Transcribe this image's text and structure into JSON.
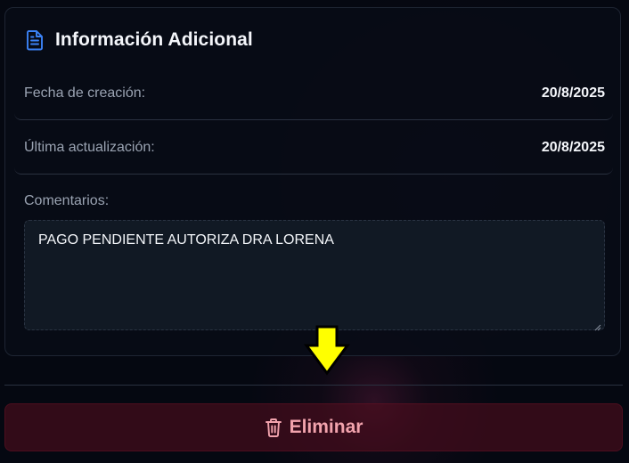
{
  "card": {
    "title": "Información Adicional",
    "title_icon": "document-icon",
    "accent_color": "#3b82f6"
  },
  "fields": {
    "created_label": "Fecha de creación:",
    "created_value": "20/8/2025",
    "updated_label": "Última actualización:",
    "updated_value": "20/8/2025"
  },
  "comments": {
    "label": "Comentarios:",
    "value": "PAGO PENDIENTE AUTORIZA DRA LORENA"
  },
  "annotation": {
    "icon": "down-arrow-icon",
    "color": "#ffff00"
  },
  "actions": {
    "delete_label": "Eliminar",
    "delete_icon": "trash-icon",
    "delete_color": "#f2a3ad"
  }
}
